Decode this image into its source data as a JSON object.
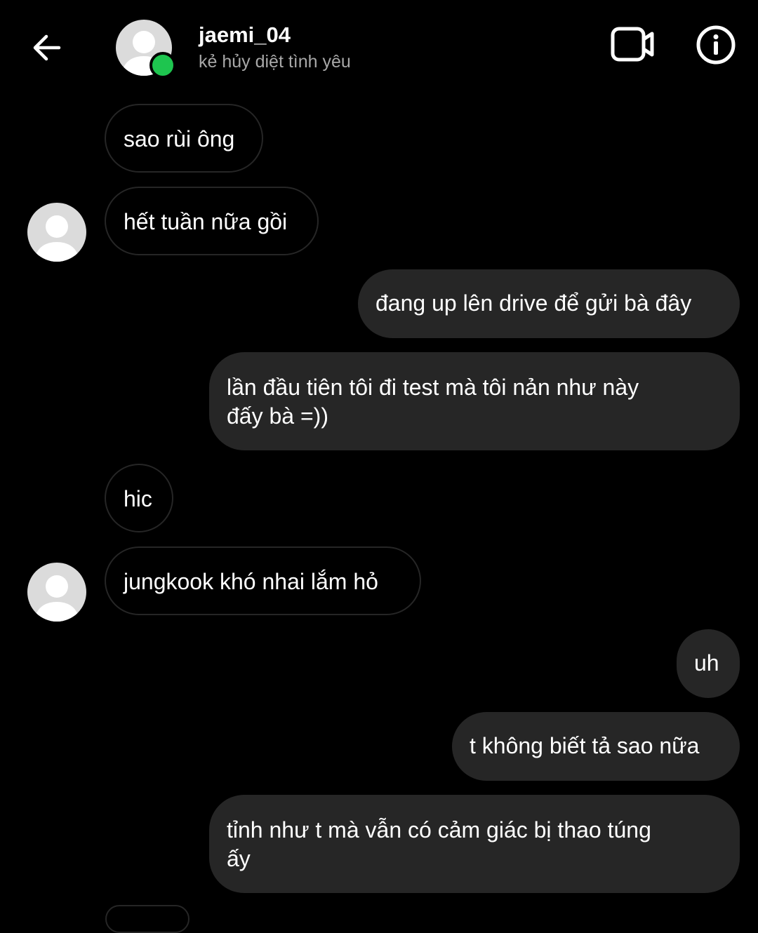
{
  "header": {
    "back_icon": "arrow-left-icon",
    "contact_name": "jaemi_04",
    "contact_status": "kẻ hủy diệt tình yêu",
    "online_color": "#1ec54f",
    "video_icon": "video-call-icon",
    "info_icon": "info-icon"
  },
  "messages": [
    {
      "sender": "them",
      "text": "sao rùi ông"
    },
    {
      "sender": "them",
      "text": "hết tuần nữa gồi"
    },
    {
      "sender": "me",
      "text": "đang up lên drive để gửi bà đây"
    },
    {
      "sender": "me",
      "text": "lần đầu tiên tôi đi test mà tôi nản như này\nđấy bà =))"
    },
    {
      "sender": "them",
      "text": "hic"
    },
    {
      "sender": "them",
      "text": "jungkook khó nhai lắm hỏ"
    },
    {
      "sender": "me",
      "text": "uh"
    },
    {
      "sender": "me",
      "text": "t không biết tả sao nữa"
    },
    {
      "sender": "me",
      "text": "tỉnh như t mà vẫn có cảm giác bị thao túng\nấy"
    }
  ],
  "colors": {
    "background": "#000000",
    "outgoing_bubble": "#262626",
    "incoming_border": "#262626",
    "text": "#ffffff",
    "subtext": "#a8a8a8"
  }
}
